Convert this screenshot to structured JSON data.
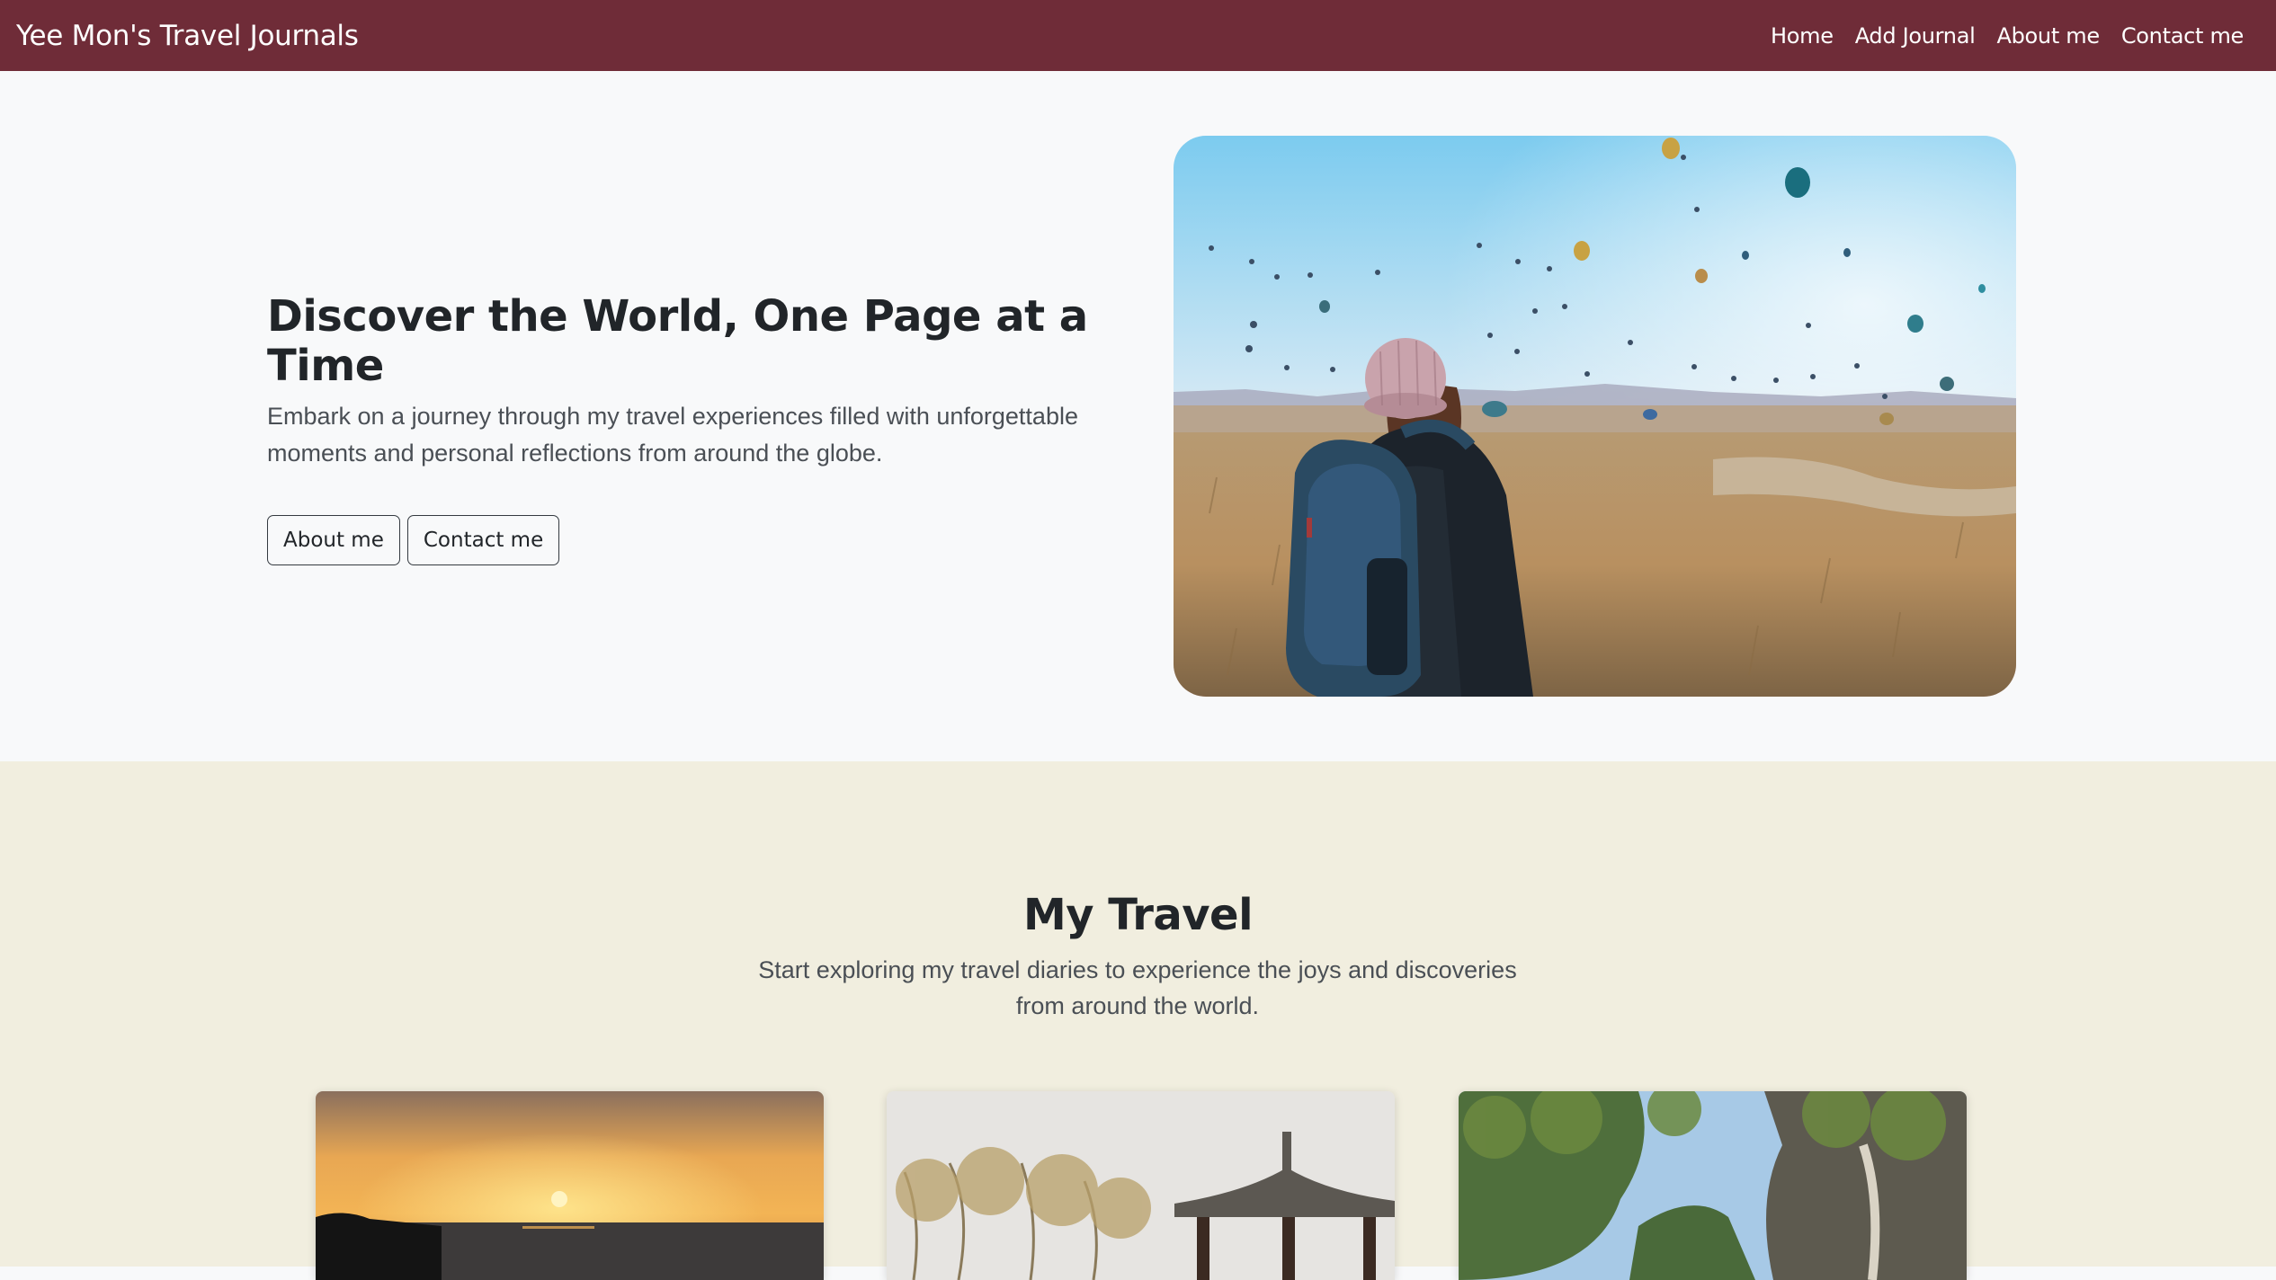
{
  "navbar": {
    "brand": "Yee Mon's Travel Journals",
    "links": [
      "Home",
      "Add Journal",
      "About me",
      "Contact me"
    ],
    "background": "#6f2c38"
  },
  "hero": {
    "title": "Discover the World, One Page at a Time",
    "lead": "Embark on a journey through my travel experiences filled with unforgettable moments and personal reflections from around the globe.",
    "buttons": [
      "About me",
      "Contact me"
    ]
  },
  "travel": {
    "title": "My Travel",
    "lead": "Start exploring my travel diaries to experience the joys and discoveries from around the world.",
    "background": "#f1eedf"
  }
}
